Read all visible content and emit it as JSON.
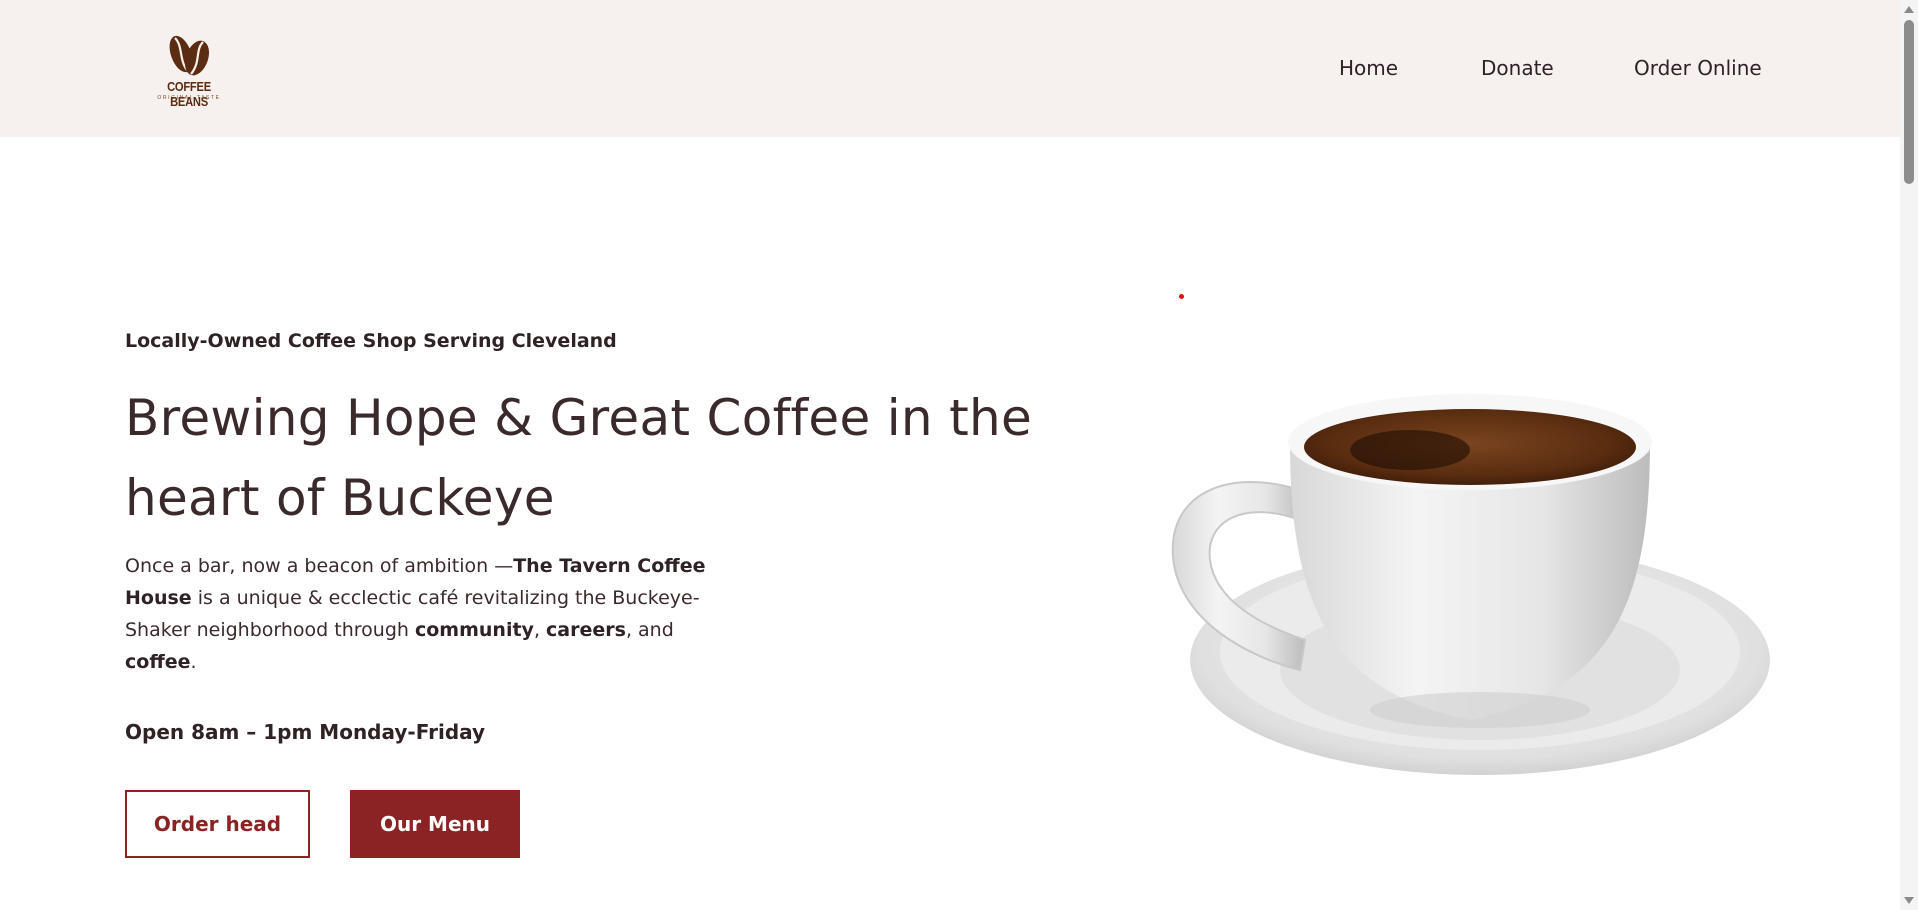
{
  "header": {
    "logo": {
      "name": "COFFEE BEANS",
      "tagline": "ORIGINAL TASTE"
    },
    "nav": [
      {
        "label": "Home"
      },
      {
        "label": "Donate"
      },
      {
        "label": "Order Online"
      }
    ]
  },
  "hero": {
    "eyebrow": "Locally-Owned Coffee Shop Serving Cleveland",
    "headline_line1": "Brewing Hope & Great Coffee in the",
    "headline_line2": "heart of Buckeye",
    "description": {
      "t1": "Once a bar, now a beacon of ambition —",
      "b1": "The Tavern Coffee House",
      "t2": " is a unique & ecclectic café revitalizing the Buckeye-Shaker neighborhood through ",
      "b2": "community",
      "t3": ", ",
      "b3": "careers",
      "t4": ", and ",
      "b4": "coffee",
      "t5": "."
    },
    "hours": "Open 8am – 1pm Monday-Friday",
    "buttons": {
      "order_label": "Order head",
      "menu_label": "Our Menu"
    }
  },
  "colors": {
    "header_bg": "#f6f0ef",
    "accent": "#8b2324",
    "text": "#3a2a2c",
    "logo_brown": "#5b2c12"
  },
  "icons": {
    "logo": "coffee-beans-logo",
    "hero_image": "coffee-cup-image"
  }
}
